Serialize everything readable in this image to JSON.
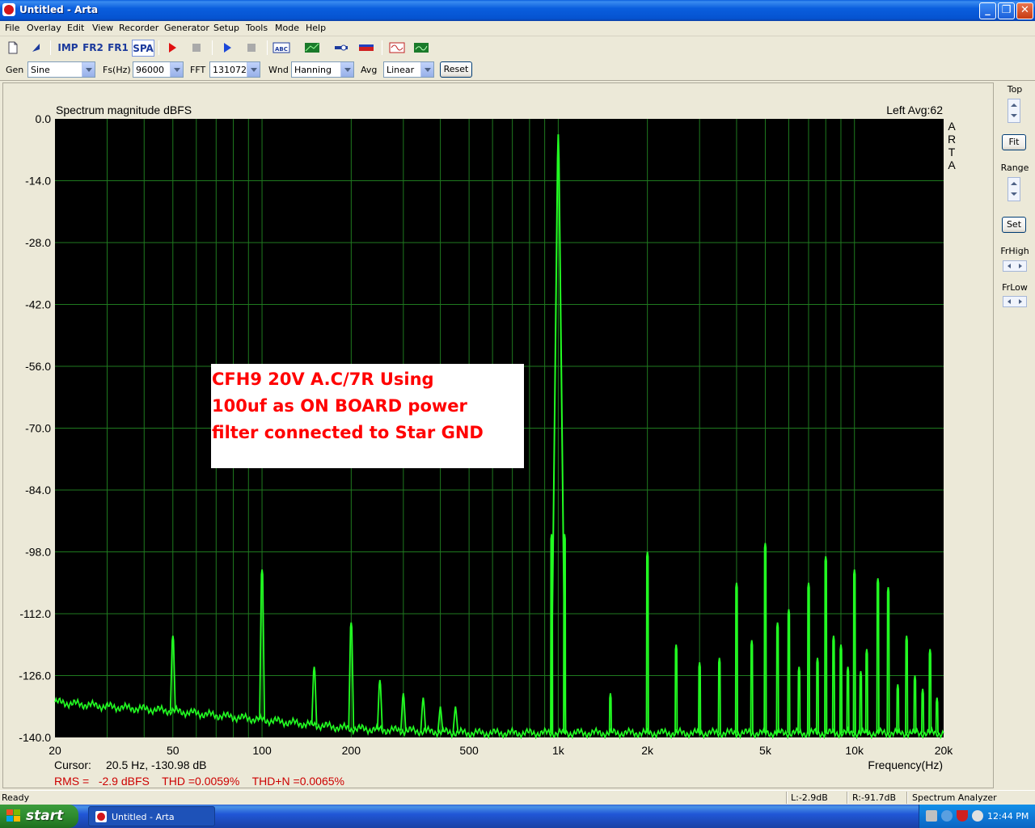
{
  "window": {
    "title": "Untitled - Arta",
    "minimize": "_",
    "maximize": "❐",
    "close": "✕"
  },
  "menu": [
    "File",
    "Overlay",
    "Edit",
    "View",
    "Recorder",
    "Generator",
    "Setup",
    "Tools",
    "Mode",
    "Help"
  ],
  "toolbar": {
    "imp": "IMP",
    "fr2": "FR2",
    "fr1": "FR1",
    "spa": "SPA"
  },
  "params": {
    "gen_label": "Gen",
    "gen_value": "Sine",
    "fs_label": "Fs(Hz)",
    "fs_value": "96000",
    "fft_label": "FFT",
    "fft_value": "131072",
    "wnd_label": "Wnd",
    "wnd_value": "Hanning",
    "avg_label": "Avg",
    "avg_value": "Linear",
    "reset_label": "Reset"
  },
  "plot": {
    "title": "Spectrum magnitude dBFS",
    "channel_info": "Left  Avg:62",
    "brand_letters": [
      "A",
      "R",
      "T",
      "A"
    ],
    "x_axis_label": "Frequency(Hz)",
    "cursor_label": "Cursor:",
    "cursor_value": "20.5 Hz, -130.98 dB",
    "metrics": "RMS =   -2.9 dBFS    THD =0.0059%    THD+N =0.0065%",
    "annotation_lines": [
      "CFH9 20V A.C/7R Using",
      "100uf as ON BOARD power",
      "filter connected to Star GND"
    ],
    "colors": {
      "background": "#000000",
      "grid": "#1f7a1f",
      "trace": "#22ff22",
      "annotation_text": "#ff0000",
      "metrics_text": "#cc0000"
    }
  },
  "chart_data": {
    "type": "line",
    "title": "Spectrum magnitude dBFS",
    "xlabel": "Frequency(Hz)",
    "ylabel": "",
    "x_scale": "log",
    "xlim": [
      20,
      20000
    ],
    "ylim": [
      -140,
      0
    ],
    "grid": true,
    "x_ticks": [
      "20",
      "50",
      "100",
      "200",
      "500",
      "1k",
      "2k",
      "5k",
      "10k",
      "20k"
    ],
    "y_ticks": [
      "0.0",
      "-14.0",
      "-28.0",
      "-42.0",
      "-56.0",
      "-70.0",
      "-84.0",
      "-98.0",
      "-112.0",
      "-126.0",
      "-140.0"
    ],
    "series": [
      {
        "noise_floor": [
          [
            20,
            -132
          ],
          [
            30,
            -133
          ],
          [
            50,
            -134
          ],
          [
            70,
            -135
          ],
          [
            100,
            -136
          ],
          [
            200,
            -138
          ],
          [
            500,
            -139
          ],
          [
            1000,
            -139
          ],
          [
            2000,
            -139
          ],
          [
            20000,
            -139
          ]
        ],
        "peaks": [
          [
            50,
            -117
          ],
          [
            100,
            -102
          ],
          [
            150,
            -124
          ],
          [
            200,
            -114
          ],
          [
            250,
            -127
          ],
          [
            300,
            -130
          ],
          [
            350,
            -131
          ],
          [
            400,
            -133
          ],
          [
            450,
            -133
          ],
          [
            950,
            -94
          ],
          [
            1000,
            -3.5
          ],
          [
            1050,
            -94
          ],
          [
            1500,
            -130
          ],
          [
            2000,
            -98
          ],
          [
            2500,
            -119
          ],
          [
            3000,
            -123
          ],
          [
            3500,
            -122
          ],
          [
            4000,
            -105
          ],
          [
            4500,
            -118
          ],
          [
            5000,
            -96
          ],
          [
            5500,
            -114
          ],
          [
            6000,
            -111
          ],
          [
            6500,
            -124
          ],
          [
            7000,
            -105
          ],
          [
            7500,
            -122
          ],
          [
            8000,
            -99
          ],
          [
            8500,
            -117
          ],
          [
            9000,
            -119
          ],
          [
            9500,
            -124
          ],
          [
            10000,
            -102
          ],
          [
            10500,
            -125
          ],
          [
            11000,
            -120
          ],
          [
            12000,
            -104
          ],
          [
            13000,
            -106
          ],
          [
            14000,
            -128
          ],
          [
            15000,
            -117
          ],
          [
            16000,
            -126
          ],
          [
            17000,
            -129
          ],
          [
            18000,
            -120
          ],
          [
            19000,
            -131
          ]
        ]
      }
    ]
  },
  "right_panel": {
    "top_label": "Top",
    "fit_label": "Fit",
    "range_label": "Range",
    "set_label": "Set",
    "frhigh_label": "FrHigh",
    "frlow_label": "FrLow"
  },
  "status": {
    "ready": "Ready",
    "left_level": "L:-2.9dB",
    "right_level": "R:-91.7dB",
    "mode": "Spectrum Analyzer"
  },
  "taskbar": {
    "start": "start",
    "task": "Untitled - Arta",
    "clock": "12:44 PM"
  }
}
